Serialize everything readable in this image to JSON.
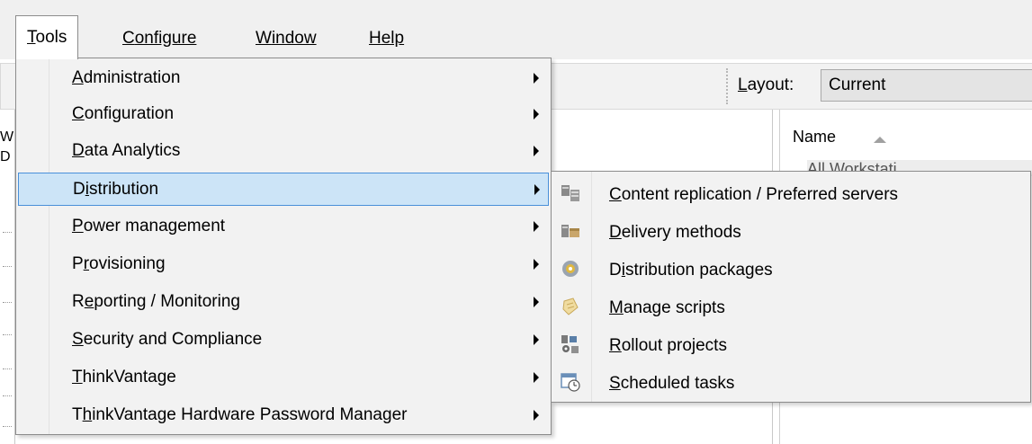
{
  "menubar": {
    "items": [
      {
        "key": "T",
        "rest": "ools"
      },
      {
        "key": "C",
        "rest": "onfigure"
      },
      {
        "key": "W",
        "rest": "indow"
      },
      {
        "key": "H",
        "rest": "elp"
      }
    ]
  },
  "toolbar": {
    "layout_label": "Layout:",
    "layout_value": "Current"
  },
  "left_pane": {
    "fragments": [
      "W",
      "D"
    ]
  },
  "right_pane": {
    "column_name": "Name",
    "faint_row": "All Workstati..."
  },
  "tools_menu": {
    "items": [
      {
        "pre": "",
        "key": "A",
        "post": "dministration"
      },
      {
        "pre": "",
        "key": "C",
        "post": "onfiguration"
      },
      {
        "pre": "",
        "key": "D",
        "post": "ata Analytics"
      },
      {
        "pre": "D",
        "key": "i",
        "post": "stribution"
      },
      {
        "pre": "",
        "key": "P",
        "post": "ower management"
      },
      {
        "pre": "P",
        "key": "r",
        "post": "ovisioning"
      },
      {
        "pre": "R",
        "key": "e",
        "post": "porting / Monitoring"
      },
      {
        "pre": "",
        "key": "S",
        "post": "ecurity and Compliance"
      },
      {
        "pre": "",
        "key": "T",
        "post": "hinkVantage"
      },
      {
        "pre": "T",
        "key": "h",
        "post": "inkVantage Hardware Password Manager"
      }
    ]
  },
  "distribution_submenu": {
    "items": [
      {
        "pre": "",
        "key": "C",
        "post": "ontent replication / Preferred servers",
        "icon": "content-replication-icon"
      },
      {
        "pre": "",
        "key": "D",
        "post": "elivery methods",
        "icon": "delivery-methods-icon"
      },
      {
        "pre": "D",
        "key": "i",
        "post": "stribution packages",
        "icon": "distribution-packages-icon"
      },
      {
        "pre": "",
        "key": "M",
        "post": "anage scripts",
        "icon": "manage-scripts-icon"
      },
      {
        "pre": "",
        "key": "R",
        "post": "ollout projects",
        "icon": "rollout-projects-icon"
      },
      {
        "pre": "",
        "key": "S",
        "post": "cheduled tasks",
        "icon": "scheduled-tasks-icon"
      }
    ]
  }
}
